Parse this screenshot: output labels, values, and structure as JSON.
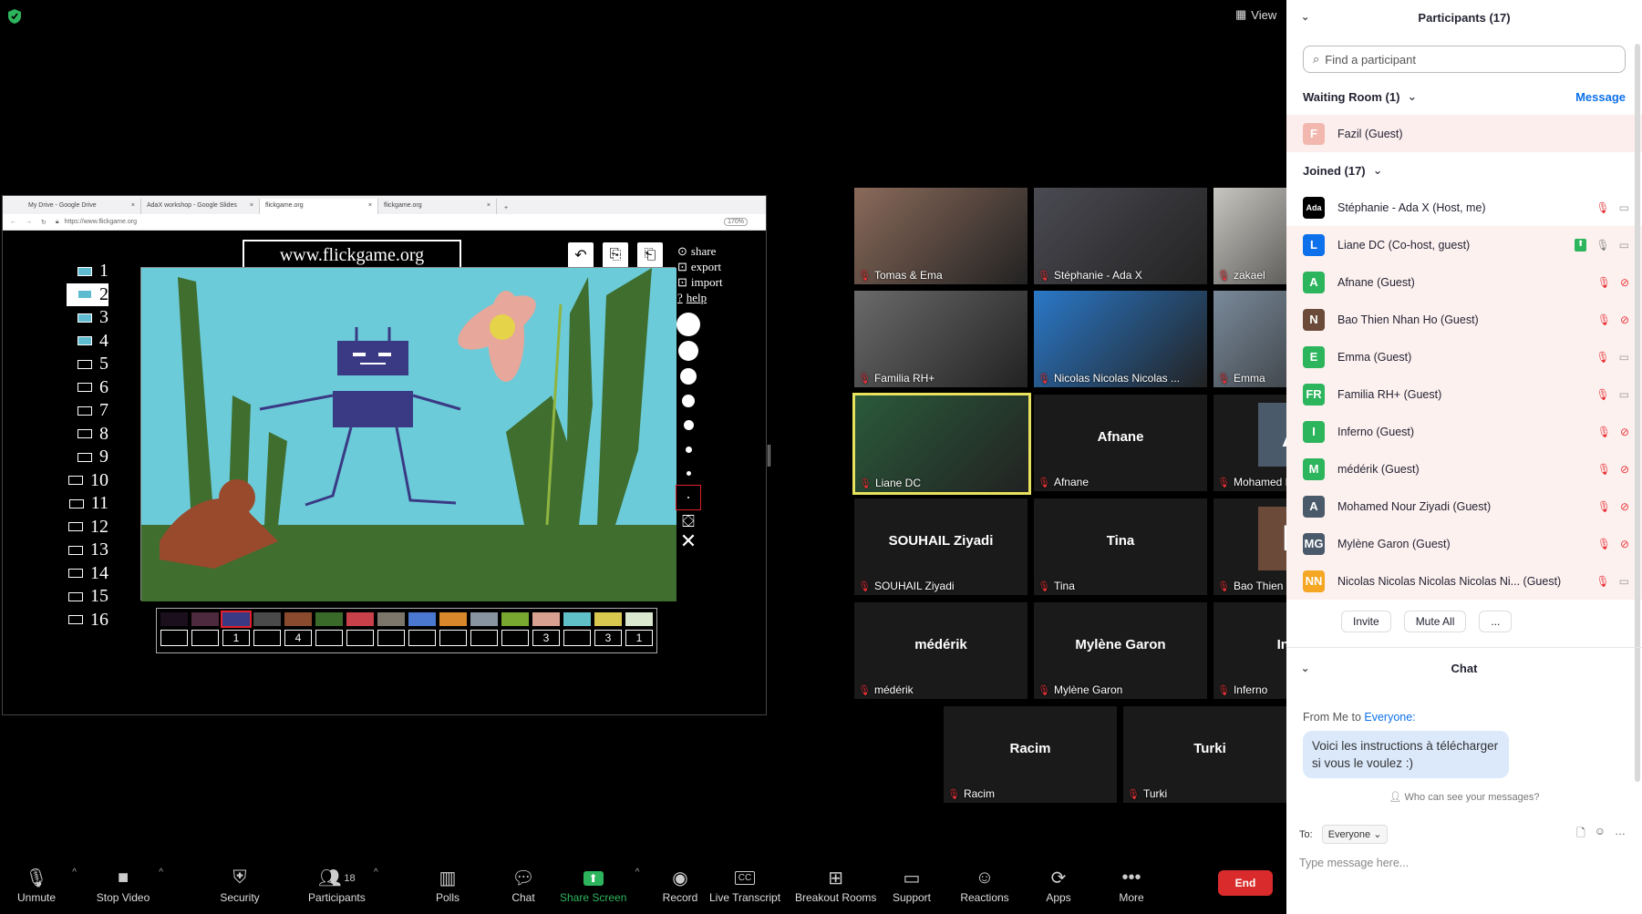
{
  "top": {
    "view_label": "View"
  },
  "browser": {
    "tabs": [
      "My Drive - Google Drive",
      "AdaX workshop - Google Slides",
      "flickgame.org",
      "flickgame.org"
    ],
    "url": "https://www.flickgame.org",
    "zoom": "170%"
  },
  "flickgame": {
    "site_title": "www.flickgame.org",
    "menu": [
      "share",
      "export",
      "import",
      "help"
    ],
    "frames": [
      "1",
      "2",
      "3",
      "4",
      "5",
      "6",
      "7",
      "8",
      "9",
      "10",
      "11",
      "12",
      "13",
      "14",
      "15",
      "16"
    ],
    "selected_frame": "2",
    "palette": [
      "#1b0f1e",
      "#4e2a3e",
      "#3a3a84",
      "#4a4a4a",
      "#8a4a2e",
      "#3a6a2a",
      "#c8404a",
      "#7c766a",
      "#4a78d0",
      "#d8882a",
      "#8894a0",
      "#78a830",
      "#d8a090",
      "#60c0c8",
      "#d8c850",
      "#dae8d0"
    ],
    "counts": [
      "",
      "",
      "1",
      "",
      "4",
      "",
      "",
      "",
      "",
      "",
      "",
      "",
      "3",
      "",
      "3",
      "1"
    ]
  },
  "gallery": [
    {
      "name": "Tomas & Ema",
      "type": "video"
    },
    {
      "name": "Stéphanie - Ada X",
      "type": "video"
    },
    {
      "name": "zakael",
      "type": "video"
    },
    {
      "name": "Familia RH+",
      "type": "video"
    },
    {
      "name": "Nicolas Nicolas Nicolas ...",
      "type": "video"
    },
    {
      "name": "Emma",
      "type": "video"
    },
    {
      "name": "Liane DC",
      "type": "video"
    },
    {
      "name": "Afnane",
      "big": "Afnane"
    },
    {
      "name": "Mohamed Nour Ziyadi",
      "avatar": "A"
    },
    {
      "name": "SOUHAIL  Ziyadi",
      "big": "SOUHAIL  Ziyadi"
    },
    {
      "name": "Tina",
      "big": "Tina"
    },
    {
      "name": "Bao Thien Nhan Ho",
      "avatar": "N"
    },
    {
      "name": "médérik",
      "big": "médérik"
    },
    {
      "name": "Mylène Garon",
      "big": "Mylène Garon"
    },
    {
      "name": "Inferno",
      "big": "Inferno"
    },
    {
      "name": "Racim",
      "big": "Racim"
    },
    {
      "name": "Turki",
      "big": "Turki"
    }
  ],
  "toolbar": {
    "unmute": "Unmute",
    "stop_video": "Stop Video",
    "security": "Security",
    "participants": "Participants",
    "participants_count": "18",
    "polls": "Polls",
    "chat": "Chat",
    "share_screen": "Share Screen",
    "record": "Record",
    "live_transcript": "Live Transcript",
    "breakout": "Breakout Rooms",
    "support": "Support",
    "reactions": "Reactions",
    "apps": "Apps",
    "more": "More",
    "end": "End"
  },
  "panel": {
    "title": "Participants (17)",
    "search_placeholder": "Find a participant",
    "waiting_label": "Waiting Room (1)",
    "message_label": "Message",
    "waiting": [
      {
        "initial": "F",
        "name": "Fazil (Guest)",
        "color": "#f2b8b0"
      }
    ],
    "joined_label": "Joined (17)",
    "joined": [
      {
        "initial": "Ada",
        "name": "Stéphanie - Ada X (Host, me)",
        "color": "#000000"
      },
      {
        "initial": "L",
        "name": "Liane DC (Co-host, guest)",
        "color": "#0e71eb"
      },
      {
        "initial": "A",
        "name": "Afnane (Guest)",
        "color": "#2db55d"
      },
      {
        "initial": "N",
        "name": "Bao Thien Nhan Ho (Guest)",
        "color": "#6b4a3a"
      },
      {
        "initial": "E",
        "name": "Emma (Guest)",
        "color": "#2db55d"
      },
      {
        "initial": "FR",
        "name": "Familia RH+ (Guest)",
        "color": "#2db55d"
      },
      {
        "initial": "I",
        "name": "Inferno (Guest)",
        "color": "#2db55d"
      },
      {
        "initial": "M",
        "name": "médérik (Guest)",
        "color": "#2db55d"
      },
      {
        "initial": "A",
        "name": "Mohamed Nour Ziyadi (Guest)",
        "color": "#4a5a6a"
      },
      {
        "initial": "MG",
        "name": "Mylène Garon (Guest)",
        "color": "#4a5a6a"
      },
      {
        "initial": "NN",
        "name": "Nicolas Nicolas Nicolas Nicolas Ni...  (Guest)",
        "color": "#f5a623"
      }
    ],
    "invite": "Invite",
    "mute_all": "Mute All",
    "more": "...",
    "chat_title": "Chat",
    "from_prefix": "From Me to ",
    "from_target": "Everyone:",
    "message": "Voici les instructions à télécharger si vous le voulez :)",
    "who_can_see": "Who can see your messages?",
    "to_label": "To:",
    "to_value": "Everyone",
    "type_placeholder": "Type message here..."
  }
}
